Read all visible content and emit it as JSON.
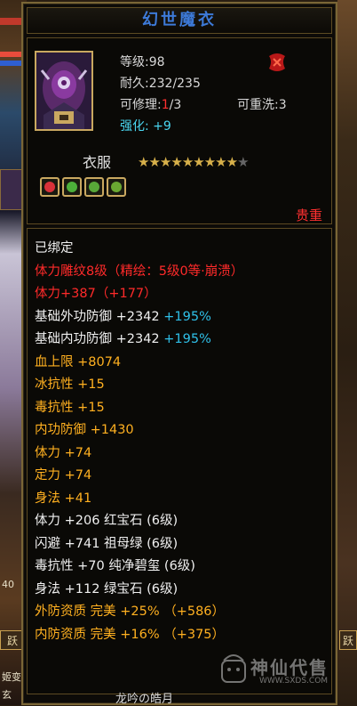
{
  "item": {
    "name": "幻世魔衣",
    "level_label": "等级:98",
    "durability_label": "耐久:232/235",
    "repair_prefix": "可修理:",
    "repair_current": "1",
    "repair_total": "/3",
    "rewash_label": "可重洗:3",
    "enhance_label": "强化: +9",
    "slot": "衣服",
    "stars_filled": 9,
    "stars_total": 10,
    "rarity": "贵重",
    "gem_colors": [
      "#d8323a",
      "#4caf3a",
      "#58a838",
      "#6aa832"
    ]
  },
  "properties": [
    {
      "text": "已绑定",
      "color": "w"
    },
    {
      "text": "体力雕纹8级（精绘：5级0等·崩溃）",
      "color": "r"
    },
    {
      "text": "体力+387（+177）",
      "color": "r"
    },
    {
      "text": "基础外功防御 +2342",
      "extra": " +195%",
      "color": "w"
    },
    {
      "text": "基础内功防御 +2342",
      "extra": " +195%",
      "color": "w"
    },
    {
      "text": "血上限 +8074",
      "color": "o"
    },
    {
      "text": "冰抗性 +15",
      "color": "o"
    },
    {
      "text": "毒抗性 +15",
      "color": "o"
    },
    {
      "text": "内功防御 +1430",
      "color": "o"
    },
    {
      "text": "体力 +74",
      "color": "o"
    },
    {
      "text": "定力 +74",
      "color": "o"
    },
    {
      "text": "身法 +41",
      "color": "o"
    },
    {
      "text": "体力 +206 红宝石 (6级)",
      "color": "w"
    },
    {
      "text": "闪避 +741 祖母绿 (6级)",
      "color": "w"
    },
    {
      "text": "毒抗性 +70 纯净碧玺 (6级)",
      "color": "w"
    },
    {
      "text": "身法 +112 绿宝石 (6级)",
      "color": "w"
    },
    {
      "text": "外防资质  完美 +25% （+586）",
      "color": "o"
    },
    {
      "text": "内防资质  完美 +16% （+375）",
      "color": "o"
    }
  ],
  "footer_text": "龙吟の皓月",
  "watermark": {
    "text": "神仙代售",
    "url": "WWW.SXDS.COM"
  },
  "side": {
    "left_texts": [
      "40",
      "姬变",
      "玄"
    ],
    "left_buttons": [
      "跃",
      "跃"
    ],
    "right_buttons": [
      "跃",
      "跃"
    ]
  }
}
